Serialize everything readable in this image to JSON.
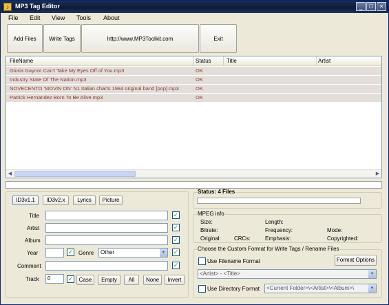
{
  "window": {
    "title": "MP3 Tag Editor"
  },
  "menu": [
    "File",
    "Edit",
    "View",
    "Tools",
    "About"
  ],
  "toolbar": {
    "add_files": "Add Files",
    "write_tags": "Write Tags",
    "website": "http://www.MP3Toolkit.com",
    "exit": "Exit"
  },
  "file_list": {
    "columns": [
      "FileName",
      "Status",
      "Title",
      "Artist"
    ],
    "rows": [
      {
        "filename": "Gloria Gaynor   Can't Take My Eyes Off of You.mp3",
        "status": "OK",
        "title": "",
        "artist": ""
      },
      {
        "filename": "Industry   State Of The Nation.mp3",
        "status": "OK",
        "title": "",
        "artist": ""
      },
      {
        "filename": "NOVECENTO  'MOVIN ON'  N1  Italian charts 1984 original band  [pop].mp3",
        "status": "OK",
        "title": "",
        "artist": ""
      },
      {
        "filename": "Patrick Hernandez   Born To Be Alive.mp3",
        "status": "OK",
        "title": "",
        "artist": ""
      }
    ]
  },
  "tabs": [
    "ID3v1.1",
    "ID3v2.x",
    "Lyrics",
    "Picture"
  ],
  "tag_form": {
    "title_label": "Title",
    "artist_label": "Artist",
    "album_label": "Album",
    "year_label": "Year",
    "genre_label": "Genre",
    "genre_value": "Other",
    "comment_label": "Comment",
    "track_label": "Track",
    "track_value": "0",
    "buttons": [
      "Case",
      "Empty",
      "All",
      "None",
      "Invert"
    ]
  },
  "status": {
    "label": "Status: 4 Files"
  },
  "mpeg_info": {
    "heading": "MPEG info",
    "size": "Size:",
    "length": "Length:",
    "bitrate": "Bitrate:",
    "frequency": "Frequency:",
    "mode": "Mode:",
    "original": "Original:",
    "crcs": "CRCs:",
    "emphasis": "Emphasis:",
    "copyrighted": "Copyrighted:"
  },
  "format": {
    "heading": "Choose the Custom Format for Write Tags / Rename Files",
    "use_filename": "Use Filename Format",
    "format_options": "Format Options",
    "filename_pattern": "<Artist> - <Title>",
    "use_directory": "Use Directory Format",
    "directory_pattern": "<Current Folder>\\<Artist>\\<Album>\\"
  }
}
